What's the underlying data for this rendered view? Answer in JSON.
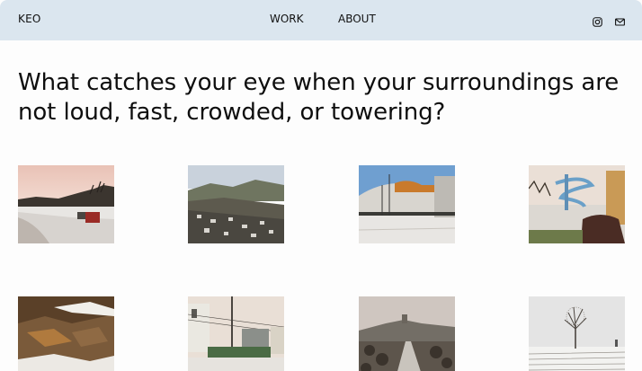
{
  "header": {
    "brand": "KEO",
    "nav": [
      {
        "label": "WORK"
      },
      {
        "label": "ABOUT"
      }
    ],
    "social_icons": [
      "instagram-icon",
      "mail-icon"
    ]
  },
  "main": {
    "headline": "What catches your eye when your surroundings are not loud, fast, crowded, or towering?",
    "photos": [
      {
        "name": "photo-snowy-lakeshore"
      },
      {
        "name": "photo-hillside-town"
      },
      {
        "name": "photo-quonset-building"
      },
      {
        "name": "photo-water-slide"
      },
      {
        "name": "photo-rock-cliff"
      },
      {
        "name": "photo-houses-power-lines"
      },
      {
        "name": "photo-town-overlook"
      },
      {
        "name": "photo-lone-tree-snow-field"
      }
    ]
  },
  "colors": {
    "header_background": "#dbe6ef",
    "page_background": "#fdfdfd",
    "text": "#111111"
  }
}
